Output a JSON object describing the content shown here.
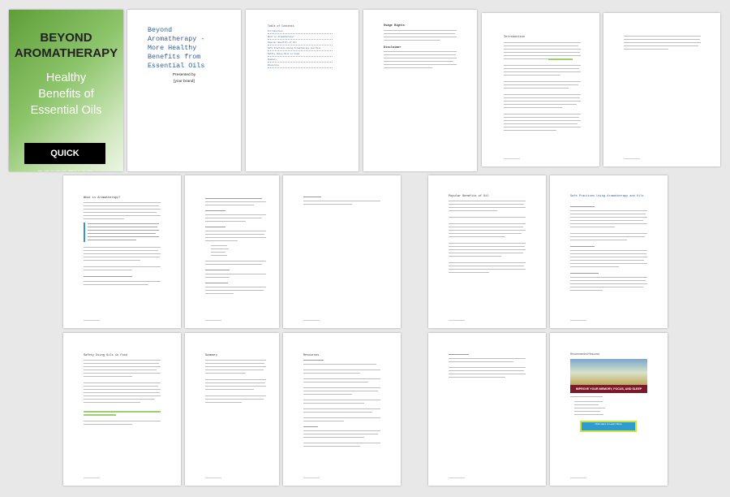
{
  "cover": {
    "title_line1": "BEYOND",
    "title_line2": "AROMATHERAPY",
    "subtitle_line1": "Healthy",
    "subtitle_line2": "Benefits of",
    "subtitle_line3": "Essential Oils",
    "badge": "QUICK REFERENCE"
  },
  "title_page": {
    "line1": "Beyond",
    "line2": "Aromatherapy -",
    "line3": "More Healthy",
    "line4": "Benefits from",
    "line5": "Essential Oils",
    "presented_by": "Presented by",
    "author": "[your brand]"
  },
  "toc": {
    "heading": "Table of Contents",
    "items": [
      "Introduction",
      "What is Aromatherapy?",
      "Popular Benefits of Oil",
      "Safe Practices Using Aromatherapy and Oils",
      "Safety Using Oils in Food",
      "Summary",
      "Resources"
    ]
  },
  "usage": {
    "heading": "Usage Rights",
    "disclaimer": "Disclaimer"
  },
  "headings": {
    "introduction": "Introduction",
    "what_is": "What is Aromatherapy?",
    "popular": "Popular Benefits of Oil",
    "safe": "Safe Practices Using Aromatherapy and Oils",
    "safety_food": "Safety Using Oils in Food",
    "summary": "Summary",
    "resources": "Resources",
    "ad": "Recommended Resource",
    "ad_banner": "IMPROVE YOUR MEMORY, FOCUS, AND SLEEP",
    "ad_button": "Click Here to Learn More"
  }
}
